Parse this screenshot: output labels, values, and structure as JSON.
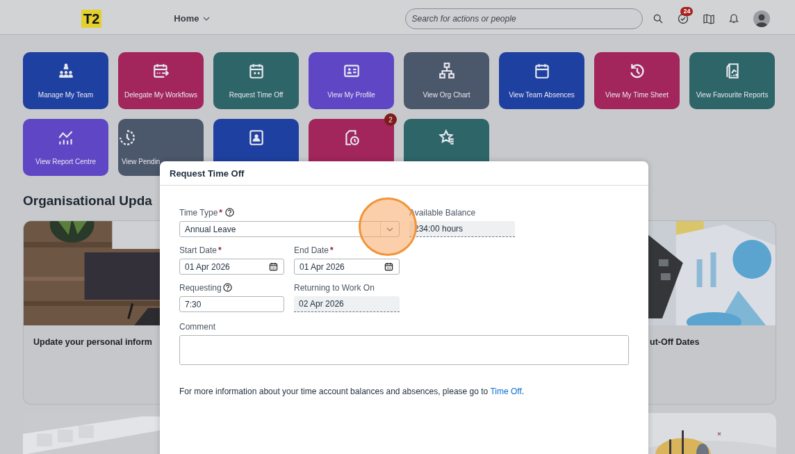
{
  "header": {
    "logo": "T2",
    "nav": "Home",
    "search_placeholder": "Search for actions or people",
    "task_badge": "24"
  },
  "quick_actions": [
    [
      {
        "label": "Manage My Team",
        "color": "#1e40a0"
      },
      {
        "label": "Delegate My Workflows",
        "color": "#a2255c"
      },
      {
        "label": "Request Time Off",
        "color": "#2d6569"
      },
      {
        "label": "View My Profile",
        "color": "#5e46c5"
      },
      {
        "label": "View Org Chart",
        "color": "#4b576a"
      },
      {
        "label": "View Team Absences",
        "color": "#1e40a0"
      },
      {
        "label": "View My Time Sheet",
        "color": "#a2255c"
      },
      {
        "label": "View Favourite Reports",
        "color": "#2d6569"
      }
    ],
    [
      {
        "label": "View Report Centre",
        "color": "#5e46c5"
      },
      {
        "label": "View Pendin",
        "color": "#4b576a"
      },
      {
        "color": "#1e40a0"
      },
      {
        "color": "#a2255c",
        "badge": "2"
      },
      {
        "color": "#2d6569"
      }
    ]
  ],
  "updates": {
    "title": "Organisational Upda",
    "cards": [
      {
        "title": "Update your personal inform",
        "kind": "picture"
      },
      {
        "title": "ut-Off Dates",
        "kind": "picture"
      }
    ]
  },
  "dialog": {
    "title": "Request Time Off",
    "fields": [
      {
        "label": "Time Type",
        "required_mark": "*",
        "help": true,
        "value": "Annual Leave",
        "kind": "select"
      },
      {
        "label": "Available Balance",
        "value": "234:00 hours",
        "kind": "readonly"
      },
      {
        "label": "Start Date",
        "required_mark": "*",
        "value": "01 Apr 2026",
        "kind": "date"
      },
      {
        "label": "End Date",
        "required_mark": "*",
        "value": "01 Apr 2026",
        "kind": "date"
      },
      {
        "label": "Requesting",
        "help": true,
        "value": "7:30",
        "kind": "text"
      },
      {
        "label": "Returning to Work On",
        "value": "02 Apr 2026",
        "kind": "readonly"
      }
    ],
    "comment_label": "Comment",
    "info": {
      "text": "For more information about your time account balances and absences, please go to ",
      "link": "Time Off",
      "tail": "."
    }
  }
}
